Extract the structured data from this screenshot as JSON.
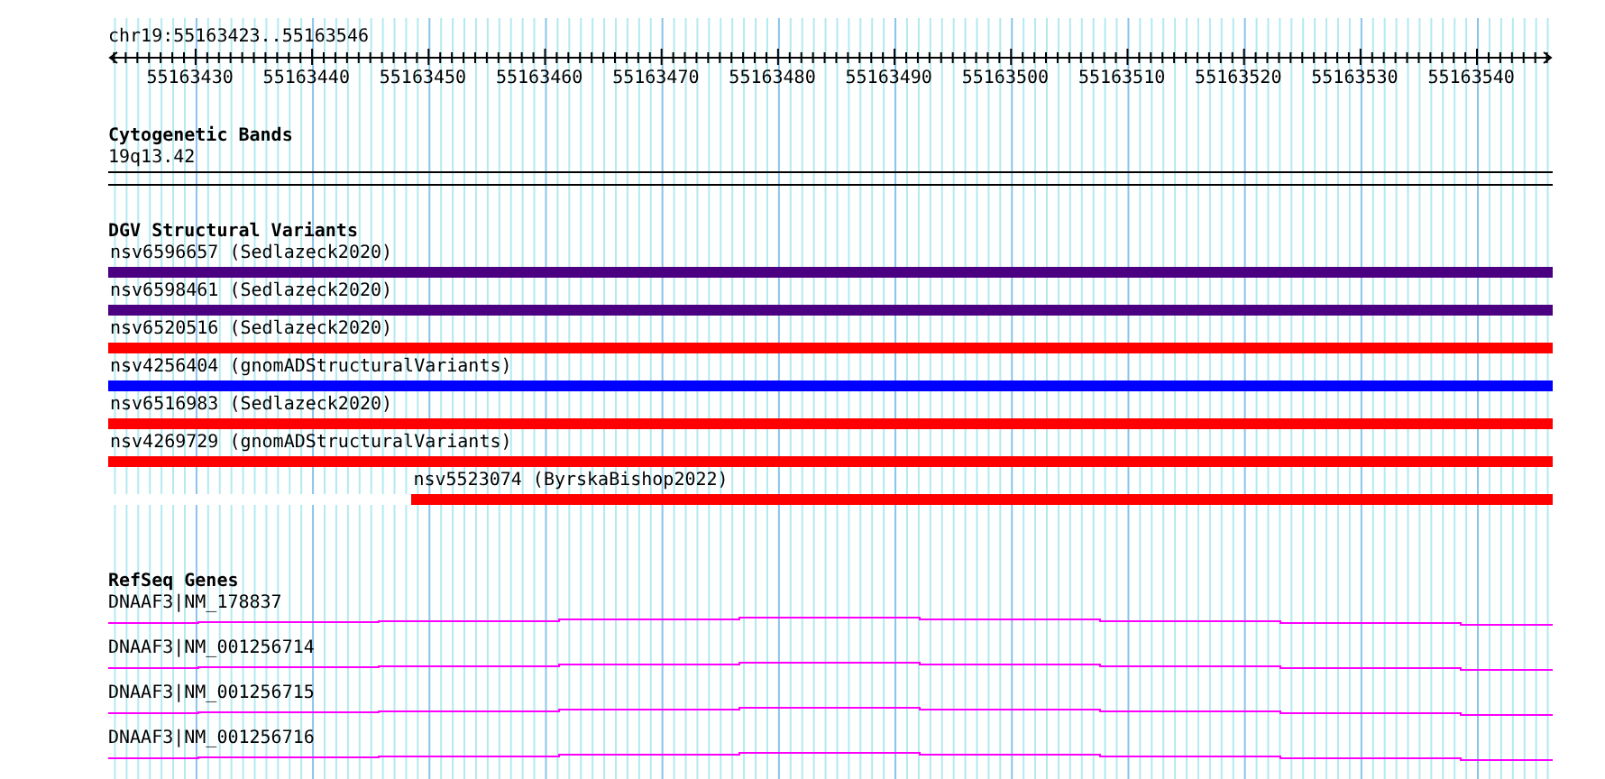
{
  "ruler": {
    "location": "chr19:55163423..55163546",
    "ticks": [
      "55163430",
      "55163440",
      "55163450",
      "55163460",
      "55163470",
      "55163480",
      "55163490",
      "55163500",
      "55163510",
      "55163520",
      "55163530",
      "55163540"
    ]
  },
  "cytogenetic_bands": {
    "title": "Cytogenetic Bands",
    "band": "19q13.42"
  },
  "dgv_structural_variants": {
    "title": "DGV Structural Variants",
    "variants": [
      {
        "label": "nsv6596657 (Sedlazeck2020)",
        "color": "#4b0082"
      },
      {
        "label": "nsv6598461 (Sedlazeck2020)",
        "color": "#4b0082"
      },
      {
        "label": "nsv6520516 (Sedlazeck2020)",
        "color": "#ff0000"
      },
      {
        "label": "nsv4256404 (gnomADStructuralVariants)",
        "color": "#0000ff"
      },
      {
        "label": "nsv6516983 (Sedlazeck2020)",
        "color": "#ff0000"
      },
      {
        "label": "nsv4269729 (gnomADStructuralVariants)",
        "color": "#ff0000"
      },
      {
        "label": "nsv5523074 (ByrskaBishop2022)",
        "color": "#ff0000",
        "level": 0.79
      }
    ]
  },
  "refseq_genes": {
    "title": "RefSeq Genes",
    "genes": [
      "DNAAF3|NM_178837",
      "DNAAF3|NM_001256714",
      "DNAAF3|NM_001256715",
      "DNAAF3|NM_001256716"
    ]
  }
}
